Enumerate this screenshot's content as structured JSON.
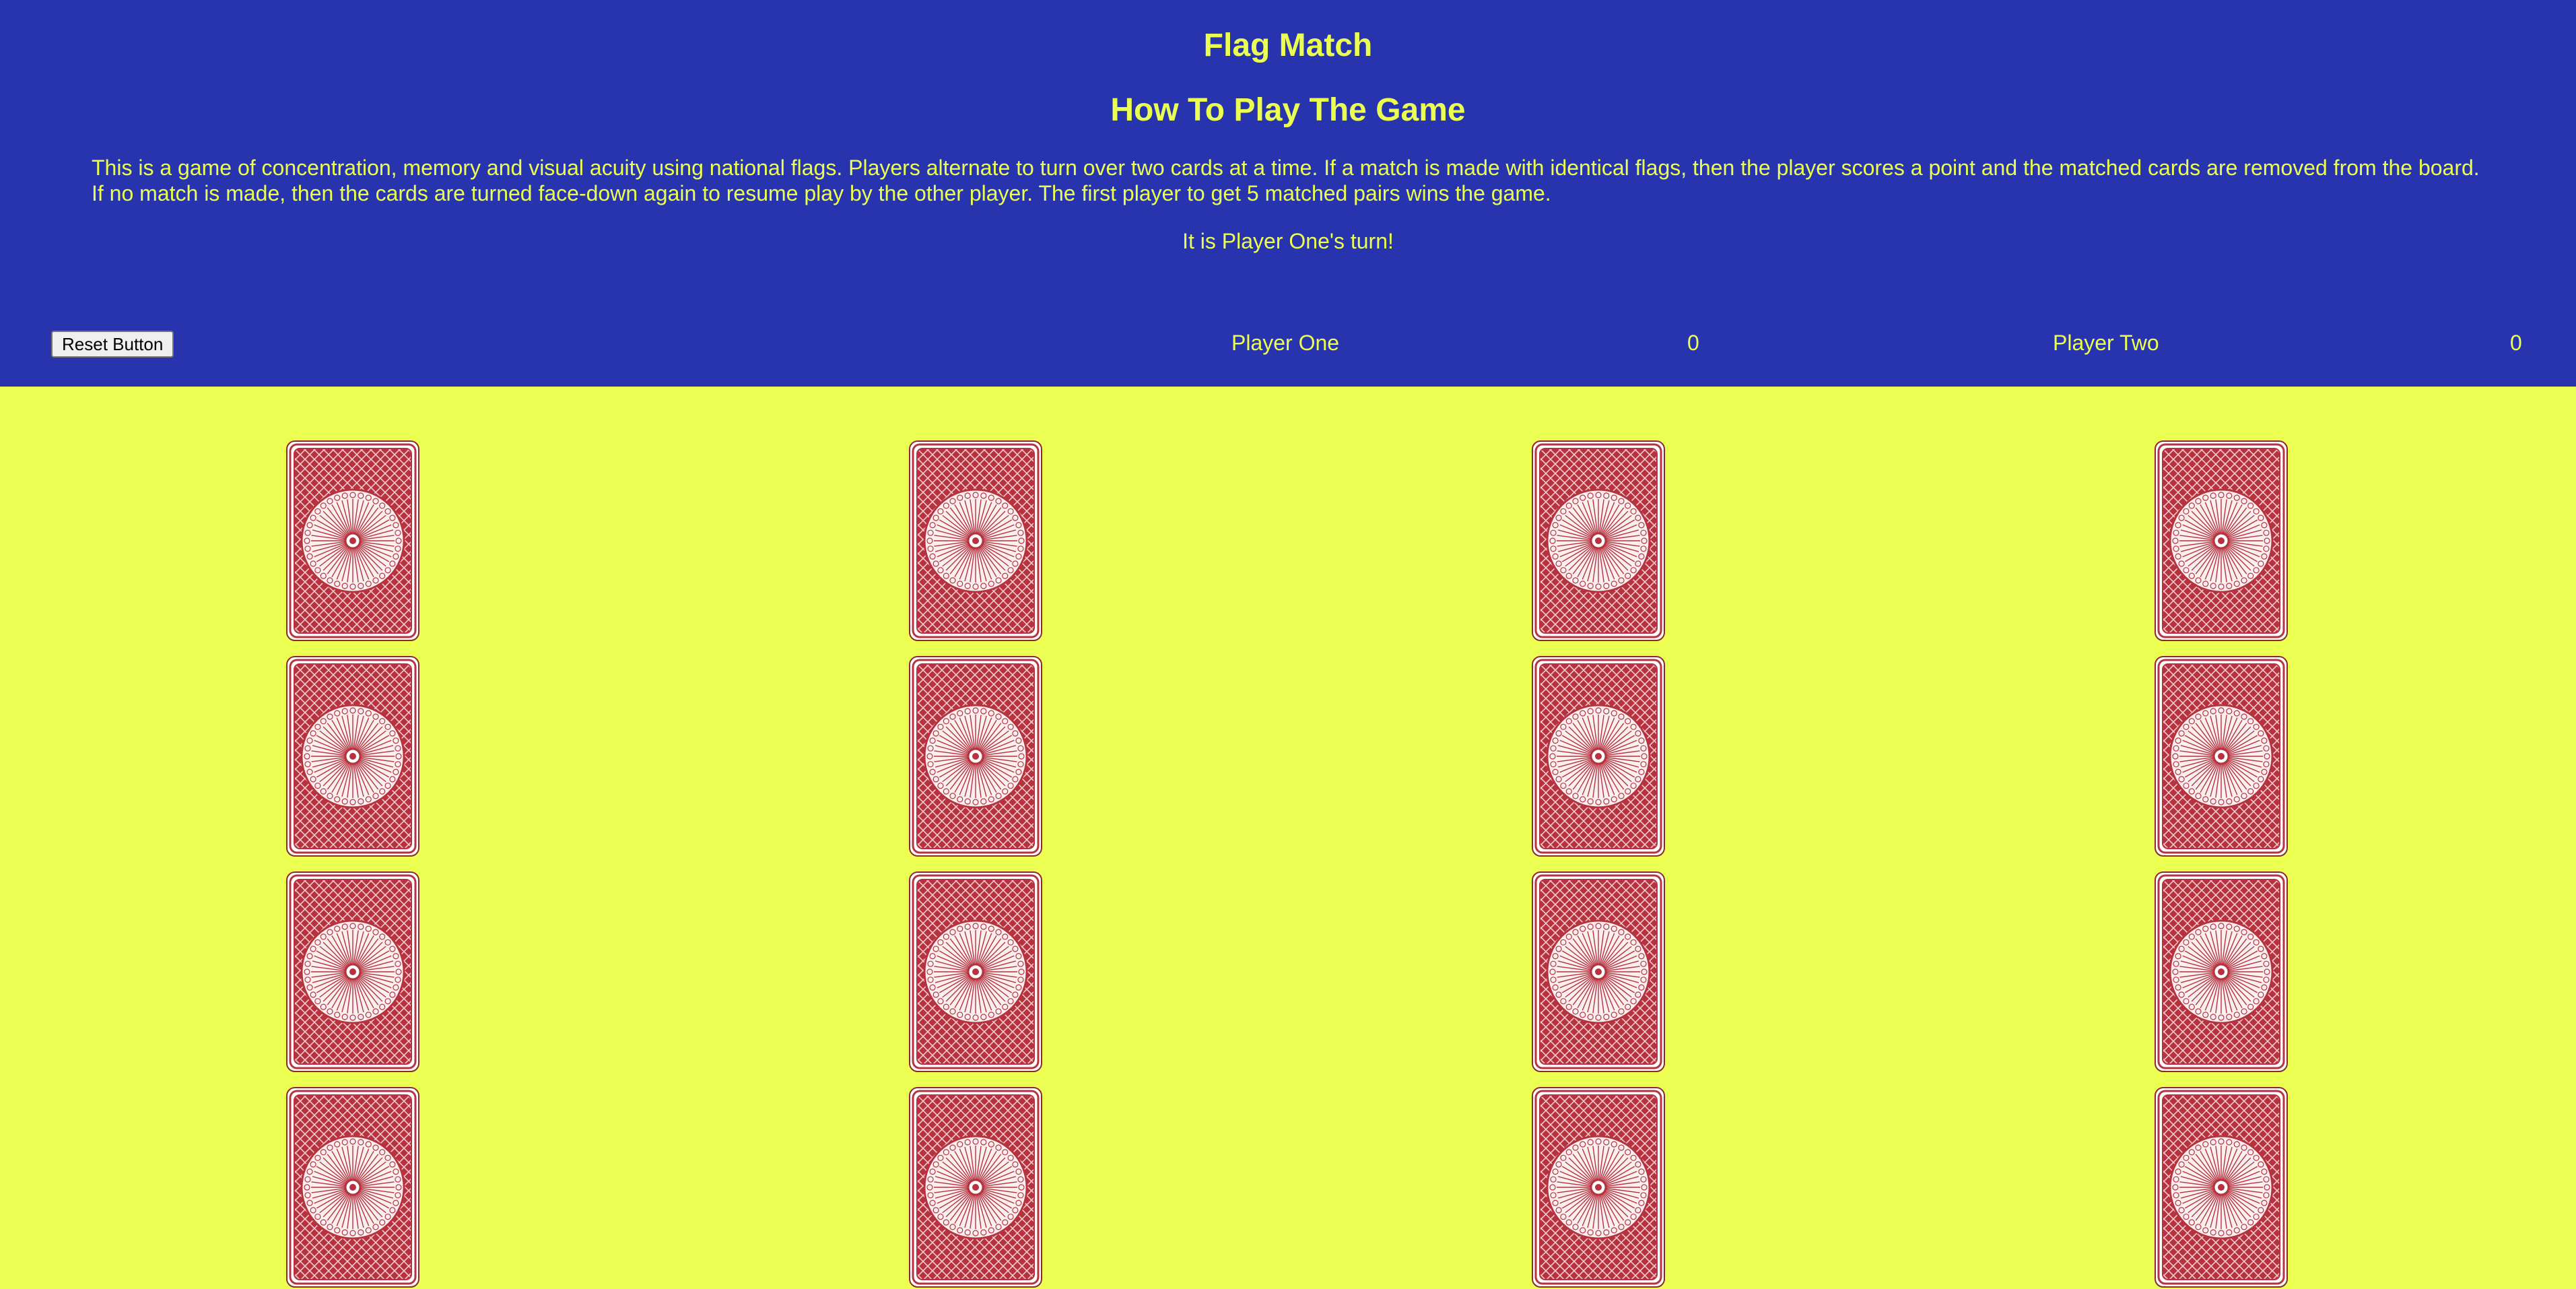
{
  "game": {
    "title": "Flag Match",
    "subtitle": "How To Play The Game",
    "instructions": "This is a game of concentration, memory and visual acuity using national flags. Players alternate to turn over two cards at a time. If a match is made with identical flags, then the player scores a point and the matched cards are removed from the board. If no match is made, then the cards are turned face-down again to resume play by the other player. The first player to get 5 matched pairs wins the game.",
    "turn_message": "It is Player One's turn!"
  },
  "controls": {
    "reset_label": "Reset Button"
  },
  "scoreboard": {
    "player_one_label": "Player One",
    "player_one_score": "0",
    "player_two_label": "Player Two",
    "player_two_score": "0"
  },
  "board": {
    "rows": 4,
    "columns": 4,
    "card_state": "face-down",
    "card_back_icon": "card-back-rosette-icon"
  },
  "colors": {
    "header_bg": "#2834ad",
    "header_text": "#ebff52",
    "page_bg": "#ebff52",
    "card_red": "#b5323e"
  }
}
